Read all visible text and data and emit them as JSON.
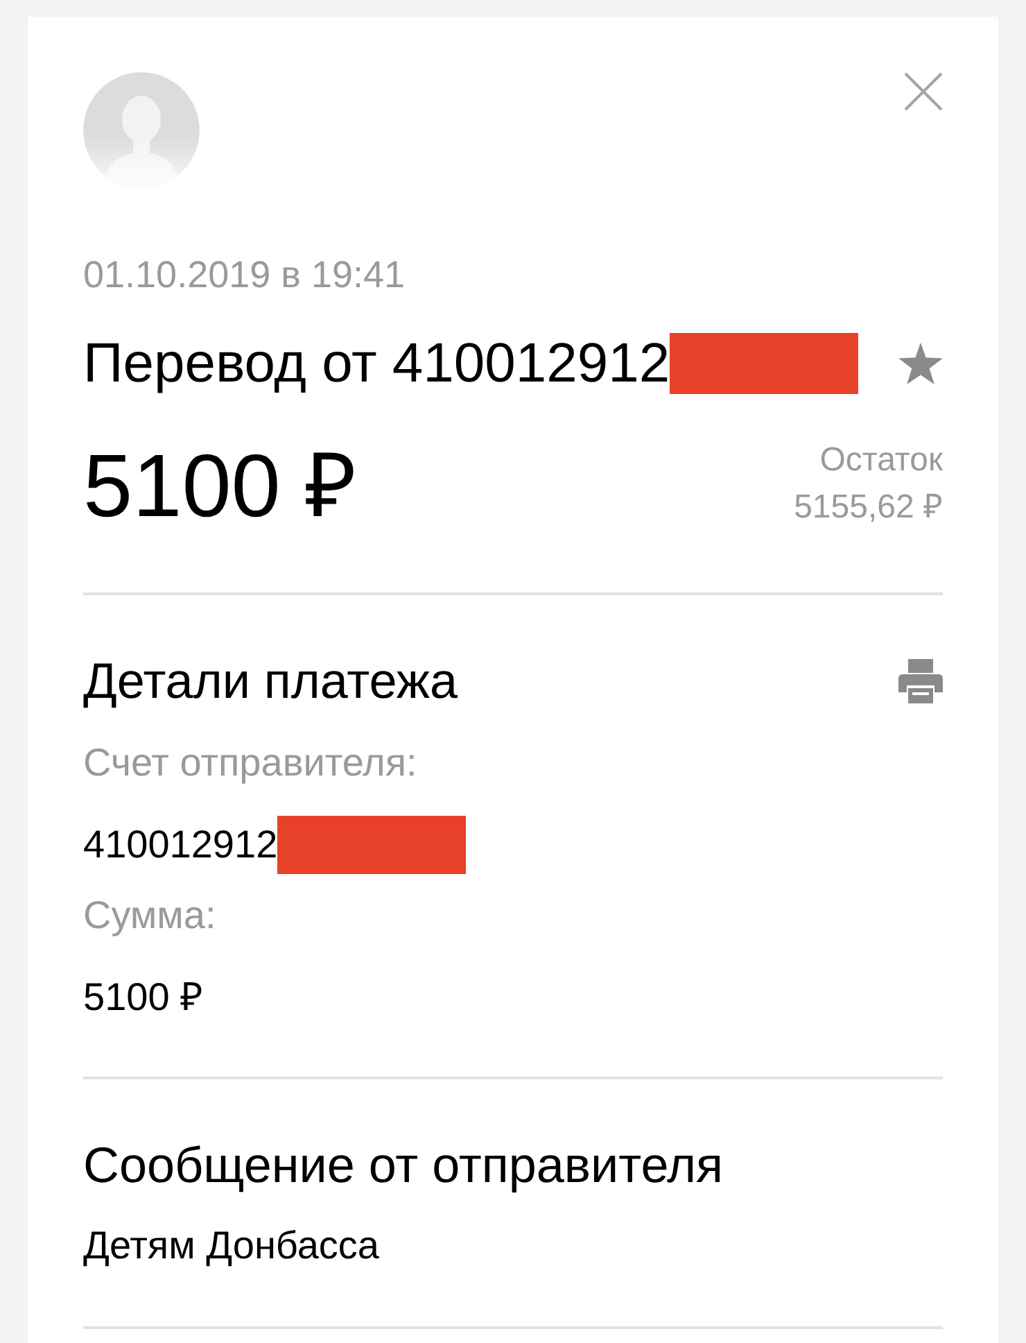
{
  "transfer": {
    "date": "01.10.2019 в 19:41",
    "title": "Перевод от 410012912",
    "title_redacted": true,
    "amount": "5100 ₽",
    "balance_label": "Остаток",
    "balance": "5155,62 ₽"
  },
  "details": {
    "title": "Детали платежа",
    "fields": [
      {
        "label": "Счет отправителя:",
        "value": "410012912",
        "redacted": true
      },
      {
        "label": "Сумма:",
        "value": "5100 ₽",
        "redacted": false
      }
    ]
  },
  "message": {
    "title": "Сообщение от отправителя",
    "text": "Детям Донбасса"
  }
}
